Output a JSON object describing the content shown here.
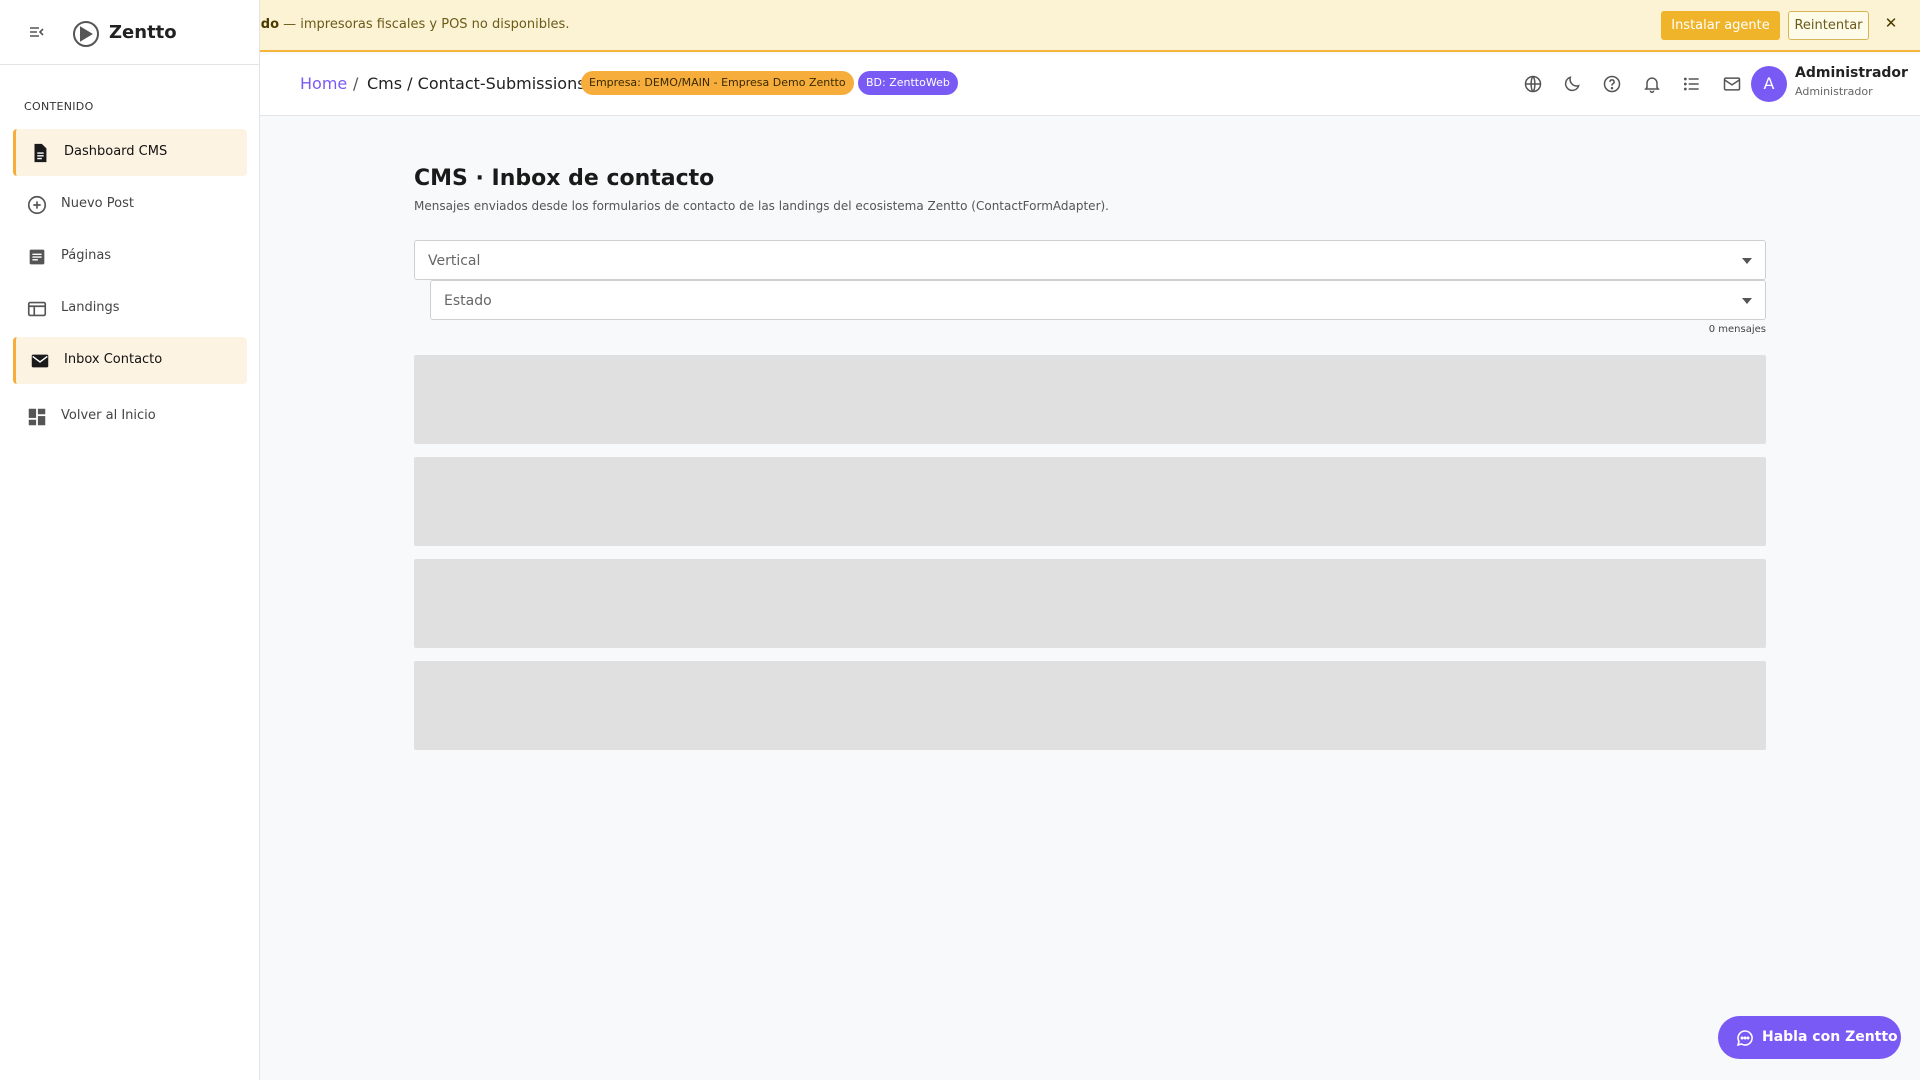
{
  "banner": {
    "bold_text": "ado",
    "text": " — impresoras fiscales y POS no disponibles.",
    "install_label": "Instalar agente",
    "retry_label": "Reintentar",
    "close_label": "✕"
  },
  "sidebar": {
    "brand": "Zentto",
    "section": "CONTENIDO",
    "items": [
      {
        "label": "Dashboard CMS",
        "icon": "document-icon",
        "active": true
      },
      {
        "label": "Nuevo Post",
        "icon": "add-circle-icon",
        "active": false
      },
      {
        "label": "Páginas",
        "icon": "article-icon",
        "active": false
      },
      {
        "label": "Landings",
        "icon": "web-icon",
        "active": false
      },
      {
        "label": "Inbox Contacto",
        "icon": "mail-icon",
        "active": true
      },
      {
        "label": "Volver al Inicio",
        "icon": "dashboard-icon",
        "active": false
      }
    ]
  },
  "header": {
    "breadcrumb": {
      "home": "Home",
      "sep": "/",
      "current": "Cms / Contact-Submissions"
    },
    "empresa_chip": "Empresa: DEMO/MAIN - Empresa Demo Zentto",
    "bd_chip": "BD: ZenttoWeb",
    "user": {
      "initial": "A",
      "name": "Administrador",
      "role": "Administrador"
    }
  },
  "main": {
    "title": "CMS · Inbox de contacto",
    "subtitle": "Mensajes enviados desde los formularios de contacto de las landings del ecosistema Zentto (ContactFormAdapter).",
    "vertical_placeholder": "Vertical",
    "estado_placeholder": "Estado",
    "count": "0 mensajes"
  },
  "chat": {
    "label": "Habla con Zentto"
  },
  "colors": {
    "accent": "#7a5af5",
    "warning": "#f6ad3c",
    "banner_bg": "#fcf3d4"
  }
}
